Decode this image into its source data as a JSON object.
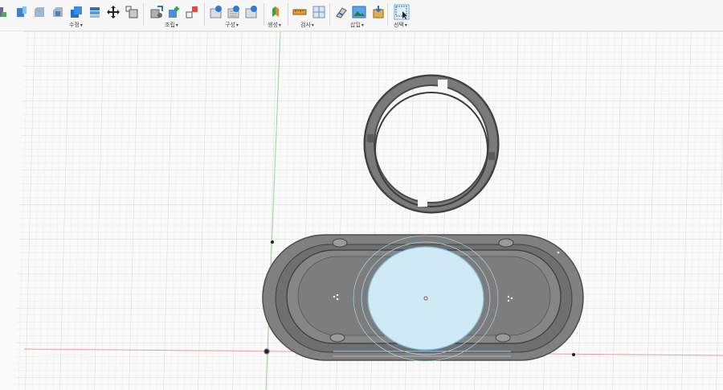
{
  "toolbar": {
    "groups": [
      {
        "label": "수정"
      },
      {
        "label": "조립"
      },
      {
        "label": "구성"
      },
      {
        "label": "검사"
      },
      {
        "label": "삽입"
      },
      {
        "label": "선택"
      }
    ],
    "icons": [
      "create-form-icon",
      "press-pull-icon",
      "fillet-icon",
      "chamfer-icon",
      "shell-icon",
      "combine-icon",
      "move-icon",
      "scale-icon",
      "new-component-icon",
      "joint-icon",
      "as-built-joint-icon",
      "offset-plane-icon",
      "plane-at-angle-icon",
      "midplane-icon",
      "axis-icon",
      "measure-icon",
      "section-analysis-icon",
      "insert-decal-icon",
      "insert-canvas-icon",
      "insert-mesh-icon",
      "select-window-icon"
    ],
    "sub_labels": [
      "생성"
    ]
  },
  "viewport": {
    "grid_color": "#dcdcdc",
    "major_grid_color": "#cfcfcf",
    "axis_green": "#9bd49b",
    "axis_red": "#e8a0a0",
    "body_color": "#7d7d7d",
    "selection_color": "#a8d8ef"
  }
}
